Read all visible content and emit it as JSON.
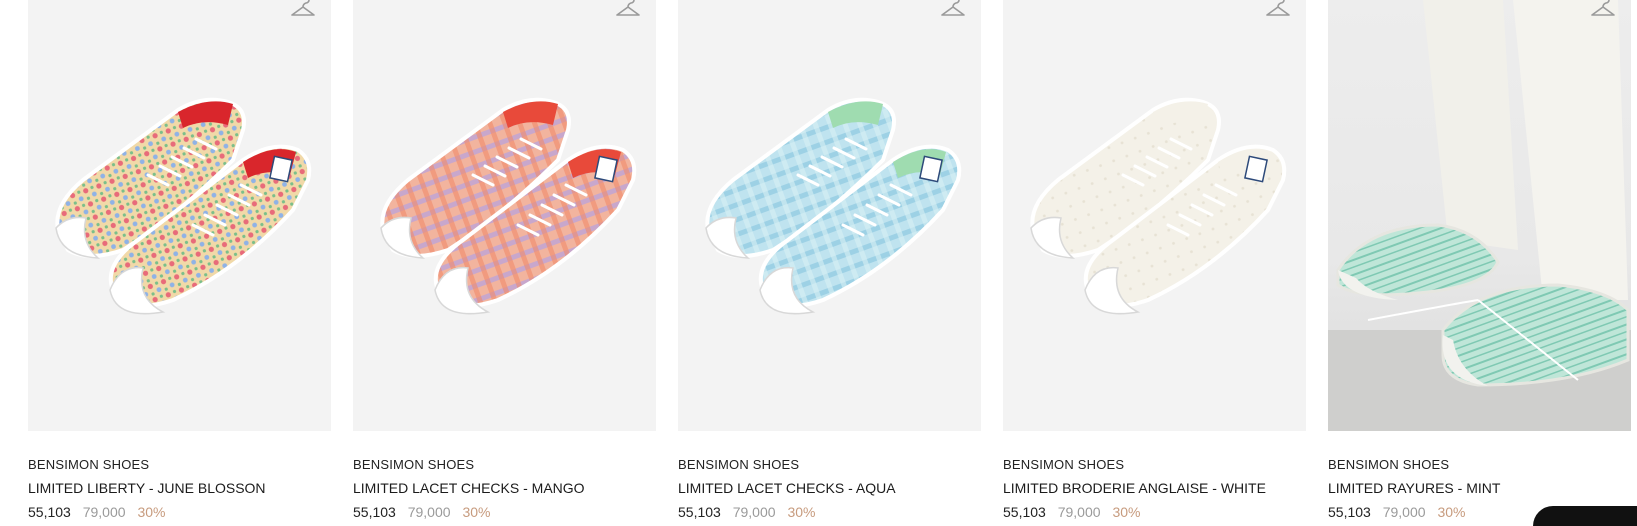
{
  "products": [
    {
      "brand": "BENSIMON SHOES",
      "name": "LIMITED LIBERTY - JUNE BLOSSON",
      "sale_price": "55,103",
      "original_price": "79,000",
      "discount": "30%",
      "pattern": "floral",
      "colors": {
        "body": "#f1d9a8",
        "accent1": "#e86b7a",
        "accent2": "#7bbf8a",
        "accent3": "#8fb2e6",
        "lining": "#d9262c"
      }
    },
    {
      "brand": "BENSIMON SHOES",
      "name": "LIMITED LACET CHECKS - MANGO",
      "sale_price": "55,103",
      "original_price": "79,000",
      "discount": "30%",
      "pattern": "check",
      "colors": {
        "body": "#f2b49e",
        "accent1": "#b7a1e0",
        "accent2": "#f08a6a",
        "lining": "#e84a3a"
      }
    },
    {
      "brand": "BENSIMON SHOES",
      "name": "LIMITED LACET CHECKS - AQUA",
      "sale_price": "55,103",
      "original_price": "79,000",
      "discount": "30%",
      "pattern": "check",
      "colors": {
        "body": "#bfe3ef",
        "accent1": "#8fc9e2",
        "accent2": "#d9f0f4",
        "lining": "#9fdcb0"
      }
    },
    {
      "brand": "BENSIMON SHOES",
      "name": "LIMITED BRODERIE ANGLAISE - WHITE",
      "sale_price": "55,103",
      "original_price": "79,000",
      "discount": "30%",
      "pattern": "plain",
      "colors": {
        "body": "#f4f1e8",
        "accent1": "#e7e2d4",
        "accent2": "#ffffff",
        "lining": "#f4f1e8"
      }
    },
    {
      "brand": "BENSIMON SHOES",
      "name": "LIMITED RAYURES - MINT",
      "sale_price": "55,103",
      "original_price": "79,000",
      "discount": "30%",
      "pattern": "stripe-photo",
      "colors": {
        "body": "#bfe6d8",
        "accent1": "#7fc9b3",
        "accent2": "#f2f2ee",
        "lining": "#f2f2ee"
      }
    }
  ],
  "icons": {
    "wishlist": "hanger-icon"
  }
}
